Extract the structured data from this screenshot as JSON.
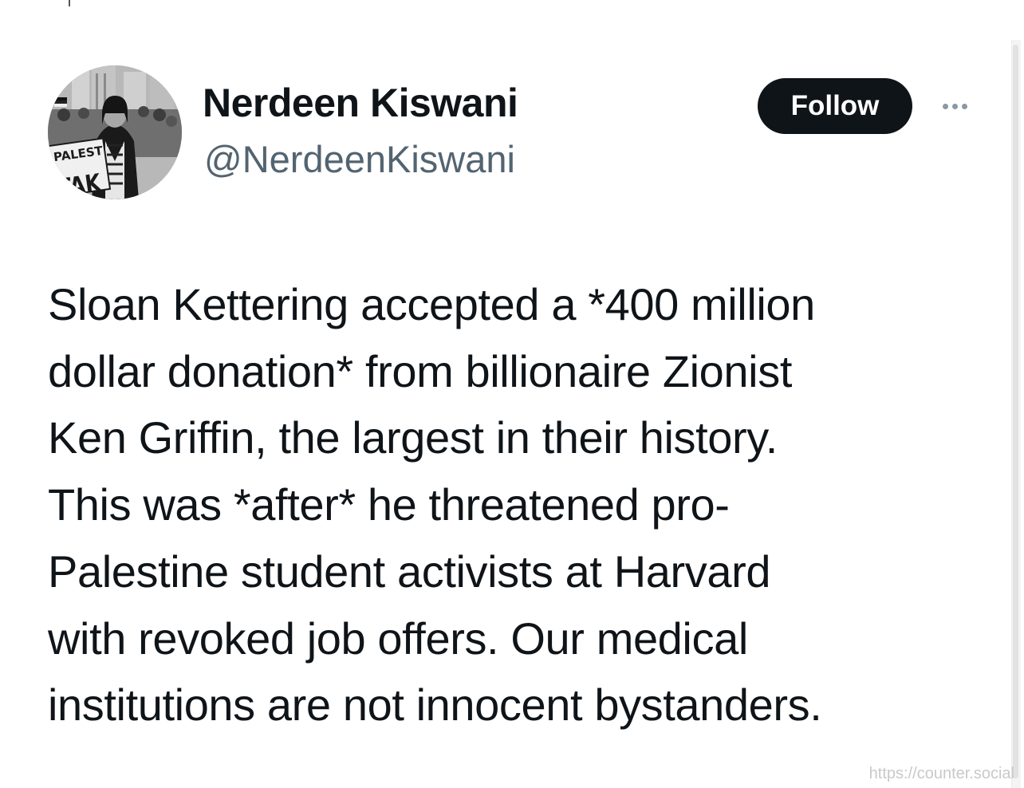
{
  "author": {
    "display_name": "Nerdeen Kiswani",
    "handle": "@NerdeenKiswani",
    "avatar_sign_text": [
      "T PALEST",
      "STAK"
    ]
  },
  "actions": {
    "follow_label": "Follow",
    "more_icon": "more-horizontal-icon"
  },
  "tweet": {
    "lines": [
      "Sloan Kettering accepted a *400 million",
      "dollar donation* from billionaire Zionist",
      "Ken Griffin, the largest in their history.",
      "This was *after* he threatened pro-",
      "Palestine student activists at Harvard",
      "with revoked job offers. Our medical",
      "institutions are not innocent bystanders."
    ]
  },
  "watermark": "https://counter.social",
  "colors": {
    "text_primary": "#0f1419",
    "text_secondary": "#536471",
    "button_bg": "#0f1419",
    "button_text": "#ffffff",
    "background": "#ffffff"
  }
}
